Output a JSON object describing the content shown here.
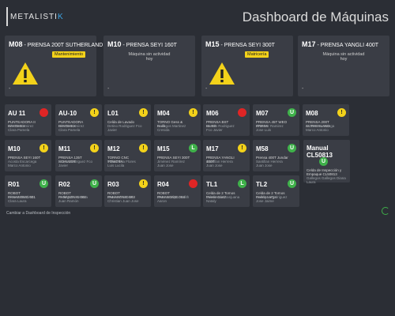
{
  "header": {
    "logo_text": "METALISTI",
    "logo_accent": "K",
    "title": "Dashboard de Máquinas"
  },
  "featured": [
    {
      "code": "M08",
      "name": " - PRENSA 200T SUTHERLAND",
      "status": "Mantenimiento",
      "line1": "",
      "line2": "",
      "warn": true,
      "dash": "-"
    },
    {
      "code": "M10",
      "name": " - PRENSA SEYI 160T",
      "status": "",
      "line1": "Máquina sin actividad",
      "line2": "hoy",
      "warn": false,
      "dash": "-"
    },
    {
      "code": "M15",
      "name": " - PRENSA SEYI 300T",
      "status": "Matricería",
      "line1": "",
      "line2": "",
      "warn": true,
      "dash": "-"
    },
    {
      "code": "M17",
      "name": " - PRENSA YANGLI 400T",
      "status": "",
      "line1": "Máquina sin actividad",
      "line2": "hoy",
      "warn": false,
      "dash": "-"
    }
  ],
  "machines": [
    {
      "code": "AU 11",
      "status": "red",
      "symbol": "",
      "desc": "PUNTEADORA II BAYOMEX",
      "op": "Oleona Ramirez Clara Pamela"
    },
    {
      "code": "AU-10",
      "status": "yellow",
      "symbol": "!",
      "desc": "PUNTEADORA BAYOMEX",
      "op": "Oleona Ramirez Clara Pamela"
    },
    {
      "code": "L01",
      "status": "yellow",
      "symbol": "!",
      "desc": "Celda de Lavado",
      "op": "Detino Rodriguez Fco Javier"
    },
    {
      "code": "M04",
      "status": "yellow",
      "symbol": "!",
      "desc": "TORNO Gess & Rock",
      "op": "Gallegos Martinez Cresida"
    },
    {
      "code": "M06",
      "status": "red",
      "symbol": "",
      "desc": "PRENSA BST BLISS",
      "op": "Fermin Rodriguez Fco Javier"
    },
    {
      "code": "M07",
      "status": "green",
      "symbol": "U",
      "desc": "PRENSA 45T WEO PRESS",
      "op": "Jimenez Ramirez Jose Luis"
    },
    {
      "code": "M08",
      "status": "yellow",
      "symbol": "!",
      "desc": "PRENSA 200T SUTHERLAND",
      "op": "Acosta Escarcega Marco Antonio"
    },
    {
      "code": "M10",
      "status": "yellow",
      "symbol": "!",
      "desc": "PRENSA SEYI 160T",
      "op": "Acosta Escarcega Marco Antonio"
    },
    {
      "code": "M11",
      "status": "yellow",
      "symbol": "!",
      "desc": "PRENSA 135T SCHULER",
      "op": "Burrar Rodriguez Fco Javier"
    },
    {
      "code": "M12",
      "status": "yellow",
      "symbol": "!",
      "desc": "TORNO CNC TOWOTA",
      "op": "Palacencia Flores Luis Lucila"
    },
    {
      "code": "M15",
      "status": "green",
      "symbol": "L",
      "desc": "PRENSA SEYI 300T",
      "op": "Jiménez Ramírez Juan Jose"
    },
    {
      "code": "M17",
      "status": "yellow",
      "symbol": "!",
      "desc": "PRENSA YANGLI 400T",
      "op": "Santillan Herrera Juan Jose"
    },
    {
      "code": "M58",
      "status": "green",
      "symbol": "U",
      "desc": "Prensa 400T Jundar",
      "op": "Santillan Herrera Juan Jose"
    },
    {
      "code": "R01",
      "status": "green",
      "symbol": "U",
      "desc": "ROBOT PANASONIC 001",
      "op": "Oleona Ramirez Clara Laura"
    },
    {
      "code": "R02",
      "status": "green",
      "symbol": "U",
      "desc": "ROBOT PANASONIC 002",
      "op": "Rodriguez Herrera Juan Ramón"
    },
    {
      "code": "R03",
      "status": "yellow",
      "symbol": "!",
      "desc": "ROBOT PANASONIC 003",
      "op": "Martinez Santos Christian Juan Jose"
    },
    {
      "code": "R04",
      "status": "red",
      "symbol": "",
      "desc": "ROBOT PANASONIC 004",
      "op": "Moreno López Edith Aaron"
    },
    {
      "code": "TL1",
      "status": "green",
      "symbol": "L",
      "desc": "Celda de 2 Tornos Peerle Cortz",
      "op": "Valenzuela Sanjuana Nataly"
    },
    {
      "code": "TL2",
      "status": "green",
      "symbol": "U",
      "desc": "Celda de 2 Tornos Peerle Larga",
      "op": "Gallegos Rodriguez Jose Jaime"
    }
  ],
  "manual": {
    "code": "Manual CL50813",
    "symbol": "U",
    "desc": "Celda de Inspección y Empaque CL50813",
    "op": "Gallegos Gallegos Diana Laura"
  },
  "footer": {
    "link_text": "Cambiar a Dashboard de Inspección"
  },
  "colors": {
    "red": "#e02525",
    "yellow": "#f3d21a",
    "green": "#3fb14a",
    "accent": "#3ea6e6"
  }
}
